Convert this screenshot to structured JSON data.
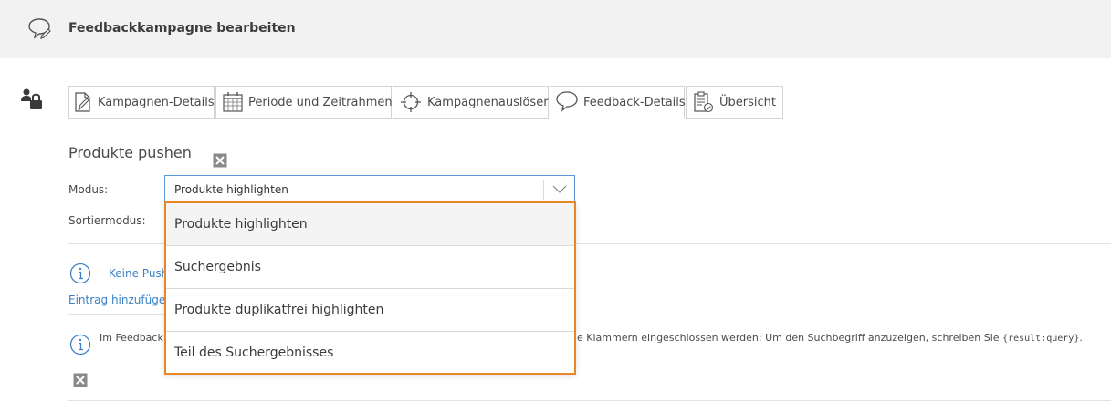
{
  "header": {
    "title": "Feedbackkampagne bearbeiten",
    "icon": "speech-bubble-pencil-icon"
  },
  "tabs": [
    {
      "label": "Kampagnen-Details",
      "icon": "document-edit-icon"
    },
    {
      "label": "Periode und Zeitrahmen",
      "icon": "calendar-icon"
    },
    {
      "label": "Kampagnenauslöser",
      "icon": "crosshair-icon"
    },
    {
      "label": "Feedback-Details",
      "icon": "speech-bubble-icon",
      "active": true
    },
    {
      "label": "Übersicht",
      "icon": "clipboard-check-icon"
    }
  ],
  "section": {
    "title": "Produkte pushen",
    "mode_label": "Modus:",
    "mode_value": "Produkte highlighten",
    "sort_label": "Sortiermodus:",
    "info_link": "Keine Push",
    "add_entry": "Eintrag hinzufügen",
    "note_prefix": "Im Feedback",
    "note_suffix": "e Klammern eingeschlossen werden: Um den Suchbegriff anzuzeigen, schreiben Sie",
    "note_code": "{result:query}",
    "note_end": "."
  },
  "dropdown": {
    "options": [
      "Produkte highlighten",
      "Suchergebnis",
      "Produkte duplikatfrei highlighten",
      "Teil des Suchergebnisses"
    ],
    "selected": "Produkte highlighten"
  },
  "colors": {
    "accent_orange": "#e8862a",
    "link_blue": "#3c82c7",
    "focus_blue": "#5b9bd5"
  }
}
